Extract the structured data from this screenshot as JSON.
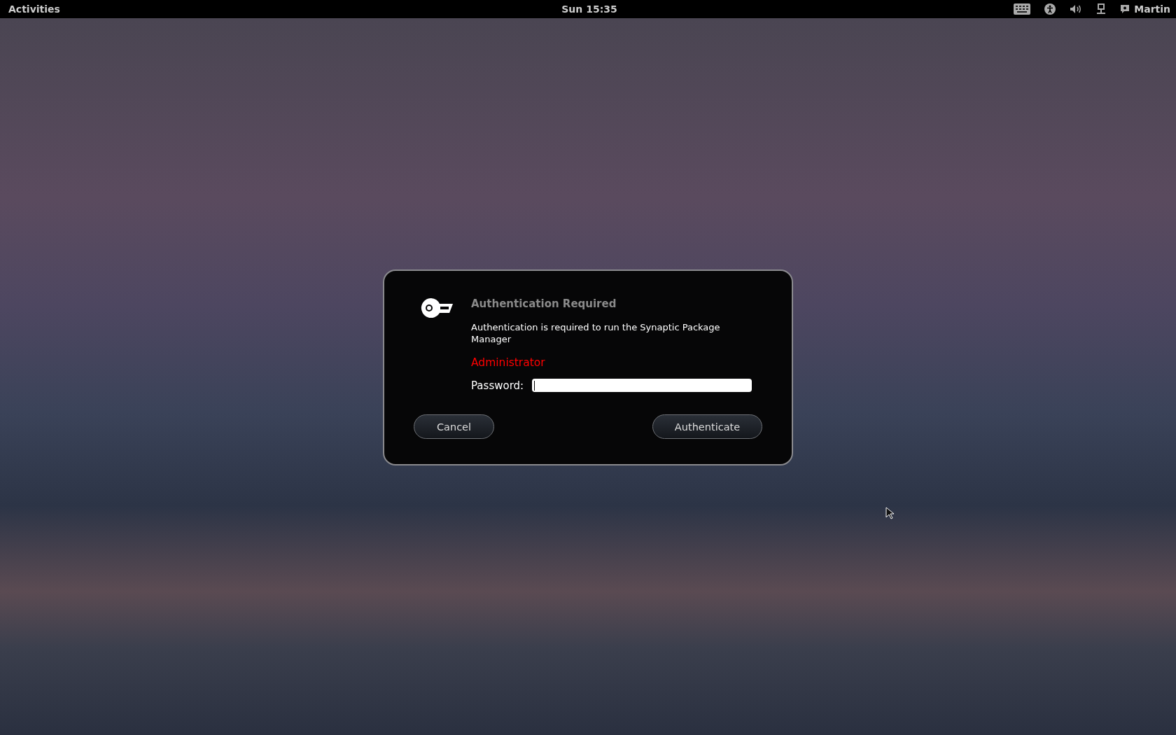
{
  "top_bar": {
    "activities": "Activities",
    "clock": "Sun 15:35",
    "user": "Martin"
  },
  "dialog": {
    "title": "Authentication Required",
    "message": "Authentication is required to run the Synaptic Package Manager",
    "identity": "Administrator",
    "password_label": "Password:",
    "buttons": [
      {
        "label": "Cancel"
      },
      {
        "label": "Authenticate"
      }
    ]
  }
}
